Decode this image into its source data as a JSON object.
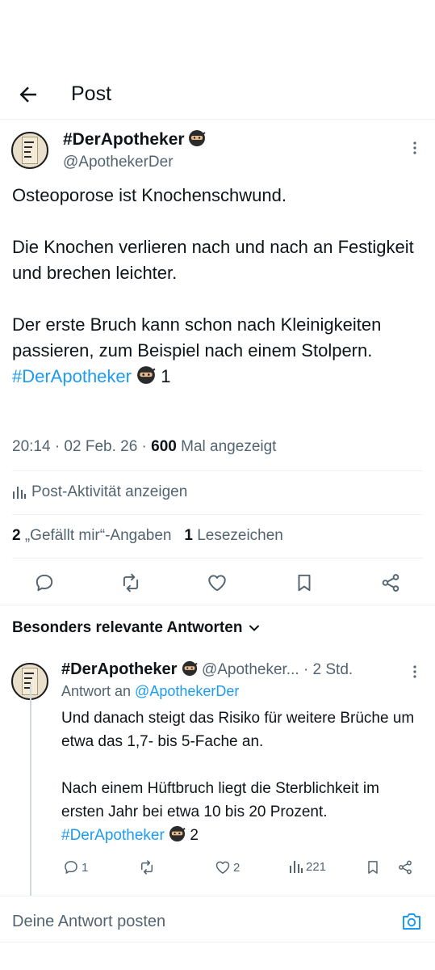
{
  "header": {
    "title": "Post"
  },
  "post": {
    "display_name": "#DerApotheker",
    "handle": "@ApothekerDer",
    "paragraphs": [
      "Osteoporose ist Knochenschwund.",
      "",
      "Die Knochen verlieren nach und nach an Festigkeit und brechen leichter.",
      "",
      "Der erste Bruch kann schon nach Kleinigkeiten passieren, zum Beispiel nach einem Stolpern."
    ],
    "hashtag": "#DerApotheker",
    "thread_index": "1",
    "time": "20:14 · 02 Feb. 26 · ",
    "views": "600",
    "views_suffix": " Mal angezeigt",
    "activity_label": "Post-Aktivität anzeigen",
    "likes_count": "2",
    "likes_label": "„Gefällt mir“-Angaben",
    "bookmarks_count": "1",
    "bookmarks_label": "Lesezeichen",
    "actions": [
      "reply",
      "repost",
      "like",
      "bookmark",
      "share"
    ]
  },
  "replies_section": {
    "title": "Besonders relevante Antworten"
  },
  "reply": {
    "display_name": "#DerApotheker",
    "handle": "@Apotheker...",
    "time": "· 2 Std.",
    "reply_to_prefix": "Antwort an ",
    "reply_to_handle": "@ApothekerDer",
    "paragraphs": [
      "Und danach steigt das Risiko für weitere Brüche um etwa das 1,7- bis 5-Fache an.",
      "",
      "Nach einem Hüftbruch liegt die Sterblichkeit im ersten Jahr bei etwa 10 bis 20 Prozent."
    ],
    "hashtag": "#DerApotheker",
    "thread_index": "2",
    "reply_count": "1",
    "repost_count": "",
    "like_count": "2",
    "view_count": "221"
  },
  "composer": {
    "placeholder": "Deine Antwort posten"
  },
  "colors": {
    "accent": "#1d9bf0",
    "text": "#0f1419",
    "muted": "#536471",
    "divider": "#eff3f4"
  }
}
